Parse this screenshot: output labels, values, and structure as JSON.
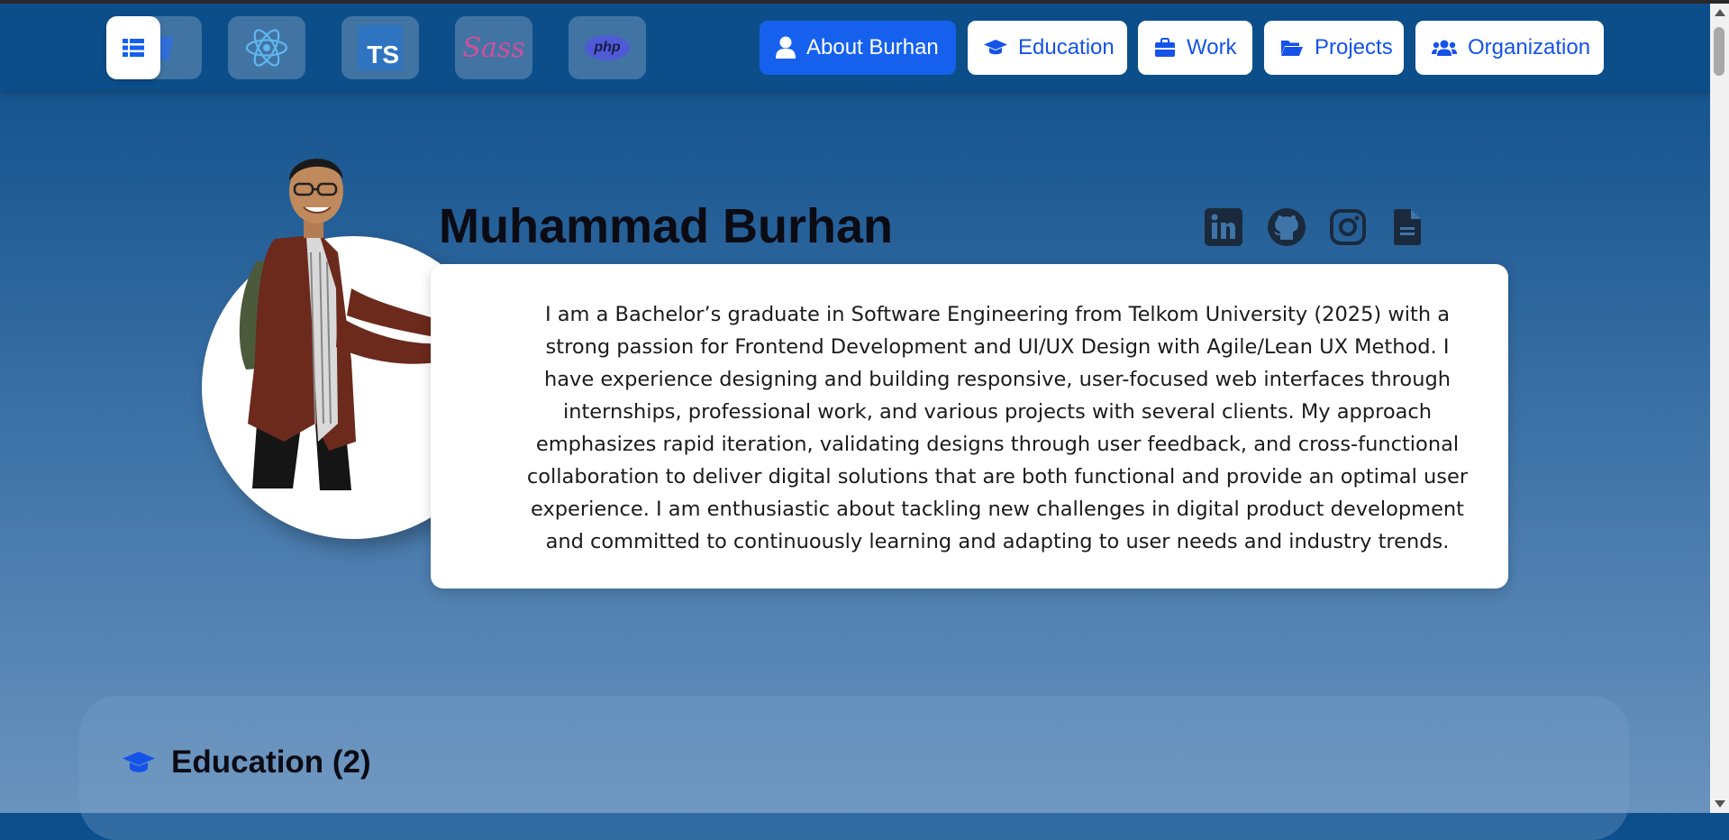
{
  "navbar": {
    "tech_icons": [
      {
        "icon": "tailwind-icon"
      },
      {
        "icon": "react-icon"
      },
      {
        "icon": "typescript-icon",
        "text": "TS"
      },
      {
        "icon": "sass-icon",
        "text": "Sass"
      },
      {
        "icon": "php-icon",
        "text": "php"
      }
    ],
    "menu_icon": "list-icon",
    "links": [
      {
        "label": "About Burhan",
        "icon": "user-icon",
        "active": true
      },
      {
        "label": "Education",
        "icon": "graduation-cap-icon"
      },
      {
        "label": "Work",
        "icon": "briefcase-icon"
      },
      {
        "label": "Projects",
        "icon": "folder-open-icon"
      },
      {
        "label": "Organization",
        "icon": "users-icon"
      }
    ]
  },
  "profile": {
    "name": "Muhammad Burhan",
    "social": [
      "linkedin-icon",
      "github-icon",
      "instagram-icon",
      "document-icon"
    ],
    "bio": "I am a Bachelor’s graduate in Software Engineering from Telkom University (2025) with a strong passion for Frontend Development and UI/UX Design with Agile/Lean UX Method. I have experience designing and building responsive, user-focused web interfaces through internships, professional work, and various projects with several clients. My approach emphasizes rapid iteration, validating designs through user feedback, and cross-functional collaboration to deliver digital solutions that are both functional and provide an optimal user experience. I am enthusiastic about tackling new challenges in digital product development and committed to continuously learning and adapting to user needs and industry trends."
  },
  "education": {
    "title": "Education (2)"
  },
  "colors": {
    "accent": "#1561ee",
    "nav_bg": "#0c4e8a",
    "text_dark": "#0b0b14"
  }
}
